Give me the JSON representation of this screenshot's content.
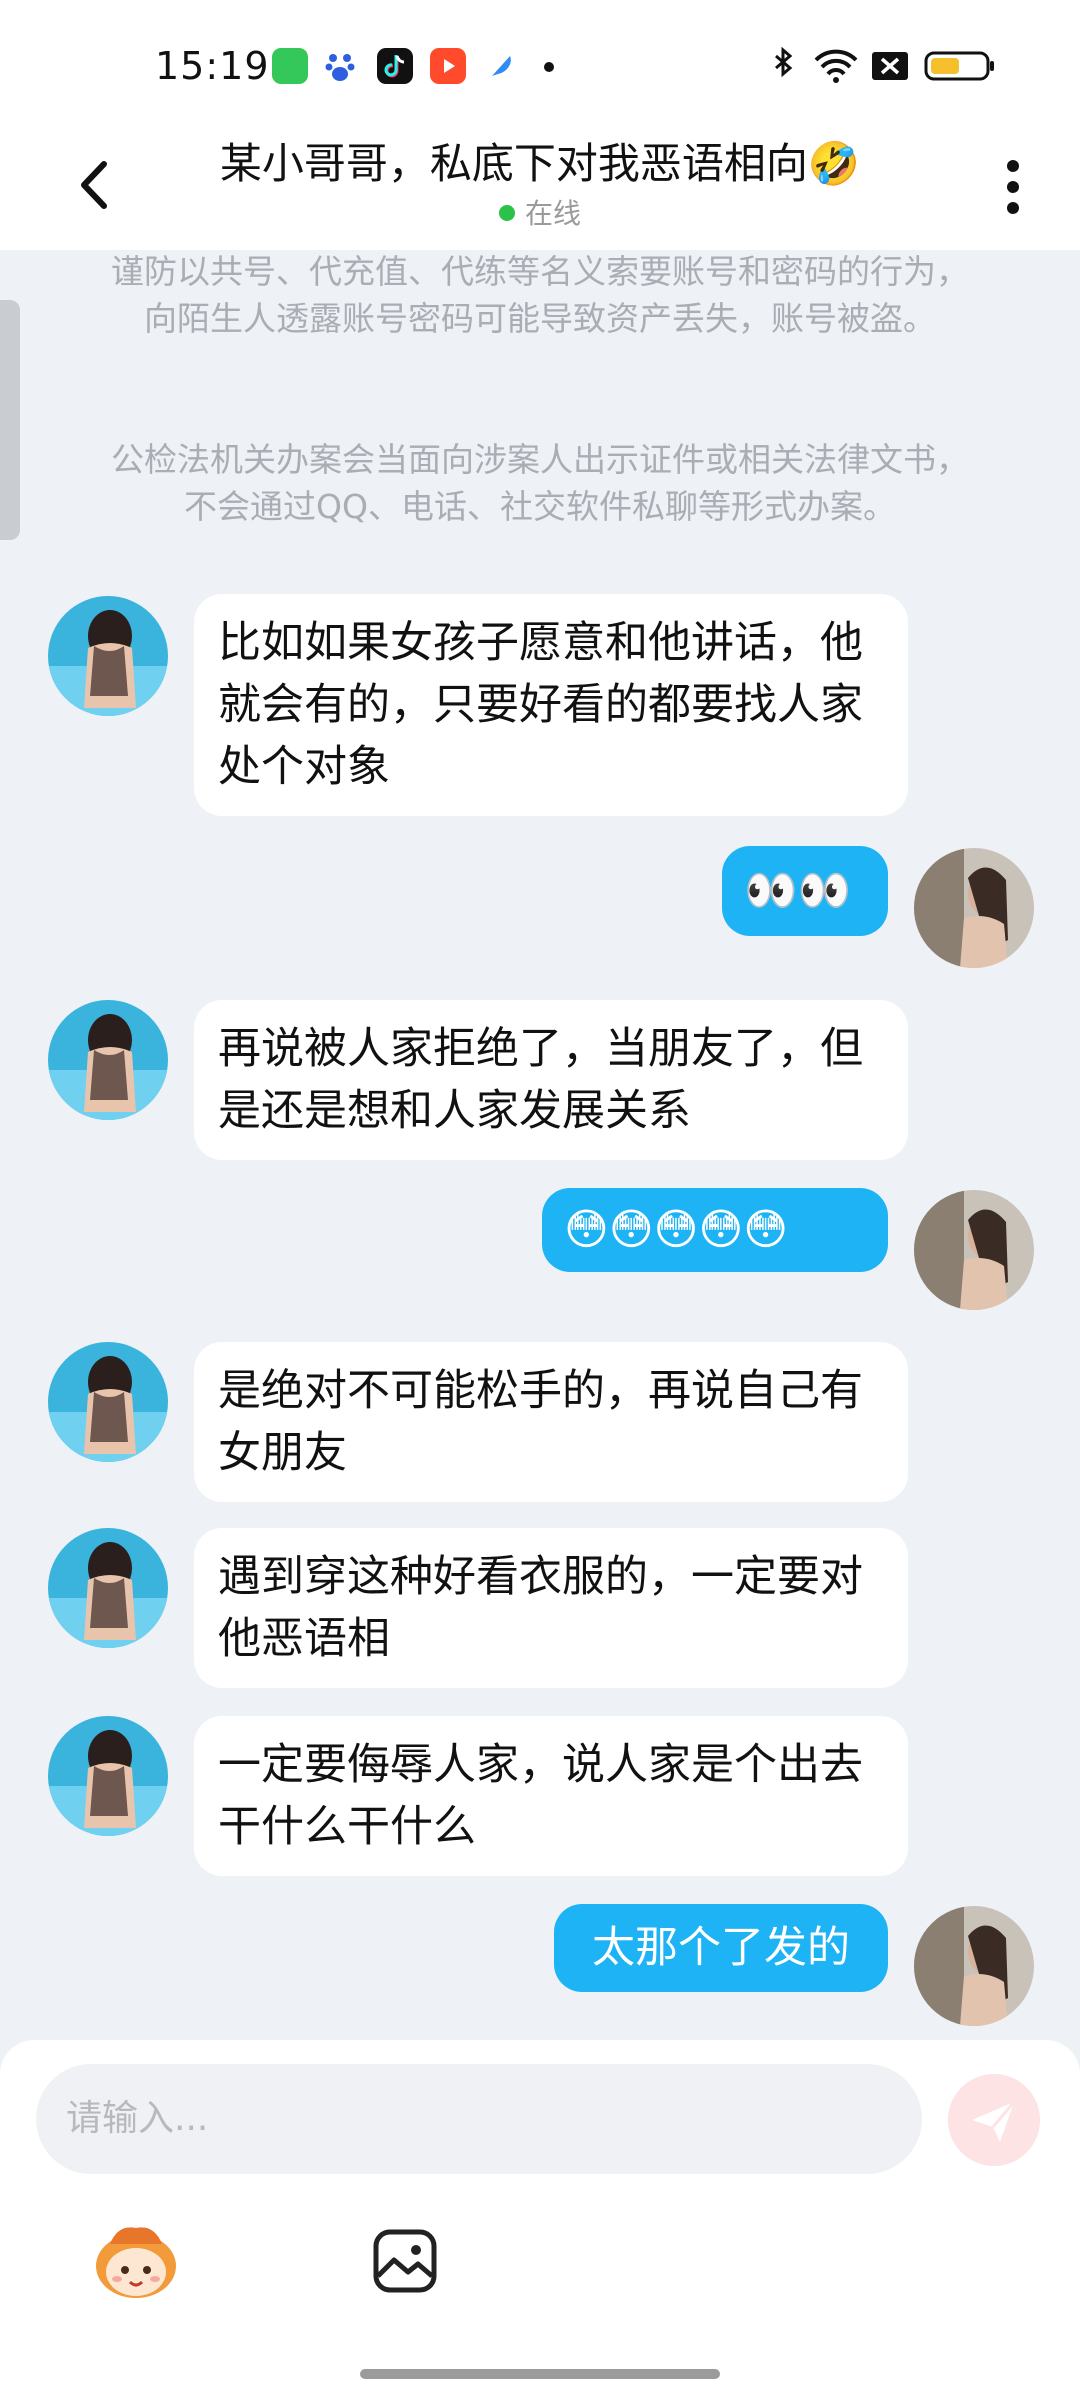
{
  "status_bar": {
    "time": "15:19",
    "app_icons": [
      "green-app-icon",
      "baidu-icon",
      "douyin-icon",
      "video-icon",
      "feather-icon"
    ],
    "right_icons": [
      "bluetooth-icon",
      "wifi-icon",
      "no-sim-icon",
      "battery-icon"
    ]
  },
  "header": {
    "title": "某小哥哥，私底下对我恶语相向🤣",
    "status": "在线"
  },
  "notices": [
    "谨防以共号、代充值、代练等名义索要账号和密码的行为，向陌生人透露账号密码可能导致资产丢失，账号被盗。",
    "公检法机关办案会当面向涉案人出示证件或相关法律文书，不会通过QQ、电话、社交软件私聊等形式办案。"
  ],
  "messages": [
    {
      "side": "left",
      "text": "比如如果女孩子愿意和他讲话，他就会有的，只要好看的都要找人家处个对象"
    },
    {
      "side": "right",
      "text": "👀👀"
    },
    {
      "side": "left",
      "text": "再说被人家拒绝了，当朋友了，但是还是想和人家发展关系"
    },
    {
      "side": "right",
      "text": "😳😳😳😳😳"
    },
    {
      "side": "left",
      "text": "是绝对不可能松手的，再说自己有女朋友"
    },
    {
      "side": "left",
      "text": "遇到穿这种好看衣服的，一定要对他恶语相"
    },
    {
      "side": "left",
      "text": "一定要侮辱人家，说人家是个出去干什么干什么"
    },
    {
      "side": "right",
      "text": "太那个了发的"
    }
  ],
  "input": {
    "placeholder": "请输入..."
  },
  "colors": {
    "accent_blue": "#1eb3f5",
    "online_green": "#2bc24a",
    "background": "#eef1f6",
    "send_disabled": "#fde3e3"
  }
}
